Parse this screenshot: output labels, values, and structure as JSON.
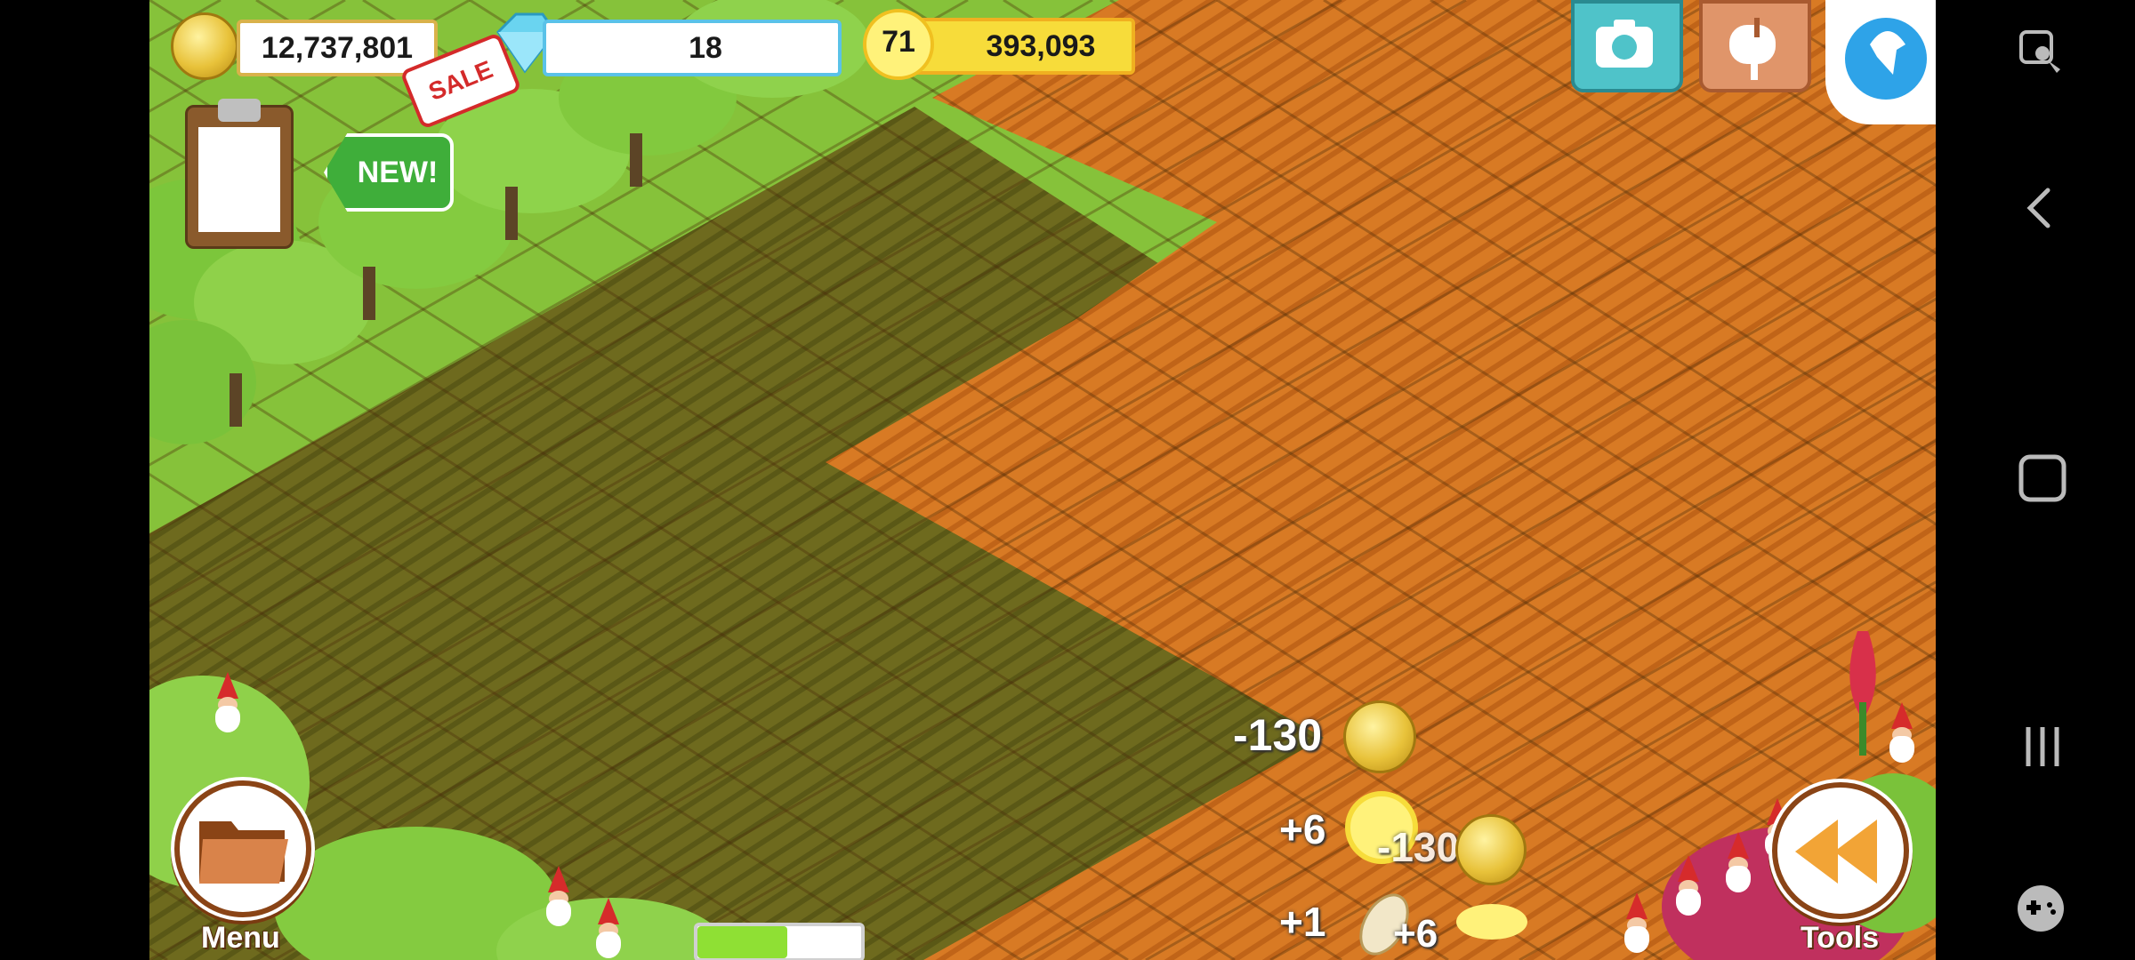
{
  "hud": {
    "coins": "12,737,801",
    "diamonds": "18",
    "level": "71",
    "xp": "393,093",
    "sale_label": "SALE",
    "new_label": "NEW!"
  },
  "floating": {
    "coin_loss": "-130",
    "xp_gain": "+6",
    "coin_partial": "-130",
    "gain_plus_one": "+1",
    "gain_plus_six": "+6"
  },
  "buttons": {
    "menu_label": "Menu",
    "tools_label": "Tools"
  },
  "progress": {
    "fraction": 0.55,
    "color": "#8fe034"
  },
  "colors": {
    "grass": "#86c23a",
    "plowed_orange": "#d87a24",
    "plowed_dark": "#6e6a1e",
    "coin_gold": "#e8c23a",
    "diamond_blue": "#6ad4f0",
    "xp_yellow": "#f7dc3a"
  },
  "icons": {
    "hud": [
      "coin-icon",
      "diamond-icon",
      "star-icon",
      "clipboard-icon",
      "camera-icon",
      "mailbox-icon",
      "refresh-icon"
    ],
    "nav": [
      "screen-lock-icon",
      "back-icon",
      "home-icon",
      "recents-icon",
      "gamepad-icon"
    ]
  }
}
